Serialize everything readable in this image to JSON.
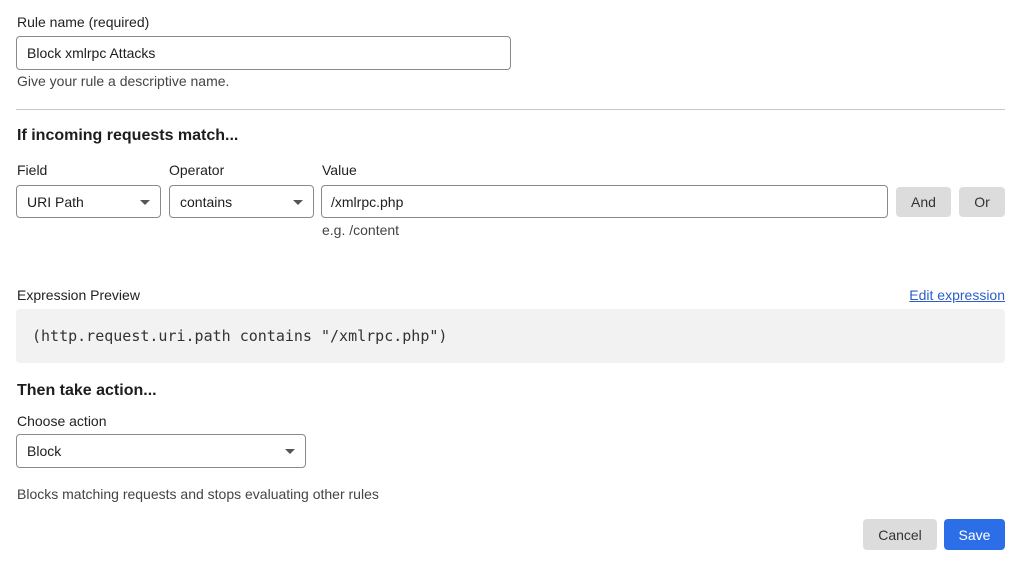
{
  "rule_name": {
    "label": "Rule name (required)",
    "value": "Block xmlrpc Attacks",
    "help": "Give your rule a descriptive name."
  },
  "match": {
    "title": "If incoming requests match...",
    "field_label": "Field",
    "operator_label": "Operator",
    "value_label": "Value",
    "field_value": "URI Path",
    "operator_value": "contains",
    "value_value": "/xmlrpc.php",
    "value_hint": "e.g. /content",
    "and_label": "And",
    "or_label": "Or"
  },
  "expression": {
    "label": "Expression Preview",
    "edit_link": "Edit expression",
    "text": "(http.request.uri.path contains \"/xmlrpc.php\")"
  },
  "action": {
    "title": "Then take action...",
    "choose_label": "Choose action",
    "selected": "Block",
    "description": "Blocks matching requests and stops evaluating other rules"
  },
  "footer": {
    "cancel_label": "Cancel",
    "save_label": "Save"
  },
  "colors": {
    "accent": "#2c6ee8",
    "link": "#2c5fc9",
    "button_grey": "#dcdcdc",
    "expression_bg": "#f2f2f2"
  }
}
